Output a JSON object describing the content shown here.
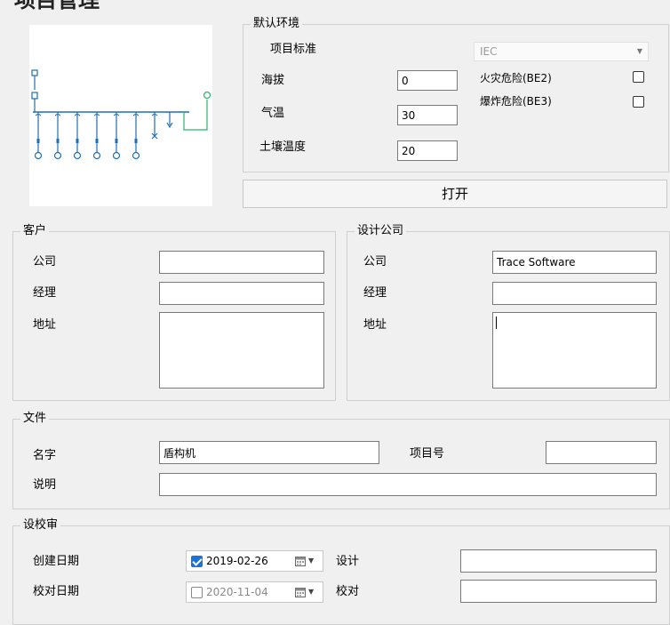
{
  "page": {
    "title": "项目管理"
  },
  "environment": {
    "title": "默认环境",
    "project_standard_label": "项目标准",
    "project_standard_value": "IEC",
    "altitude_label": "海拔",
    "altitude_value": "0",
    "temperature_label": "气温",
    "temperature_value": "30",
    "soil_temp_label": "土壤温度",
    "soil_temp_value": "20",
    "fire_risk_label": "火灾危险(BE2)",
    "explosion_risk_label": "爆炸危险(BE3)"
  },
  "open_button": {
    "label": "打开"
  },
  "customer": {
    "title": "客户",
    "company_label": "公司",
    "manager_label": "经理",
    "address_label": "地址",
    "company_value": "",
    "manager_value": "",
    "address_value": ""
  },
  "design_company": {
    "title": "设计公司",
    "company_label": "公司",
    "company_value": "Trace Software",
    "manager_label": "经理",
    "manager_value": "",
    "address_label": "地址",
    "address_value": ""
  },
  "file": {
    "title": "文件",
    "name_label": "名字",
    "name_value": "盾构机",
    "project_no_label": "项目号",
    "project_no_value": "",
    "description_label": "说明",
    "description_value": ""
  },
  "review": {
    "title": "设校审",
    "created_date_label": "创建日期",
    "created_date_value": "2019-02-26",
    "checked_date_label": "校对日期",
    "checked_date_value": "2020-11-04",
    "design_label": "设计",
    "check_label": "校对",
    "design_value": "",
    "check_value": ""
  },
  "colors": {
    "diagram_blue": "#1f6fb0",
    "diagram_green": "#2bb56a",
    "check_blue": "#1a73d9"
  }
}
